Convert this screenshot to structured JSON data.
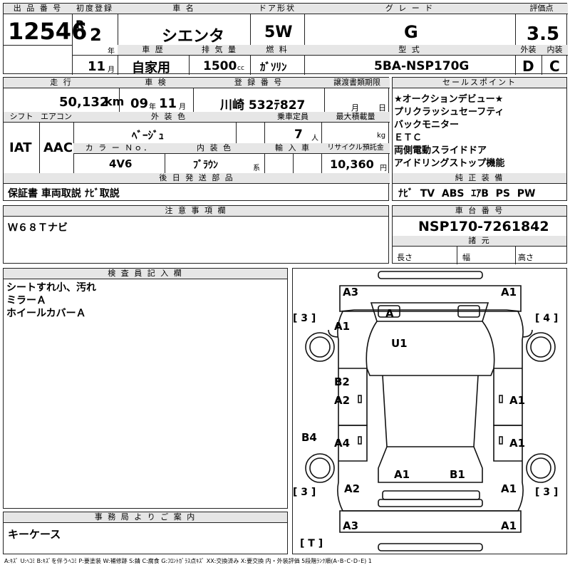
{
  "header": {
    "lot_label": "出 品 番 号",
    "lot": "12546",
    "first_reg_label": "初度登録",
    "era": "R",
    "year": "2",
    "year_unit": "年",
    "month": "11",
    "month_unit": "月",
    "car_name_label": "車 名",
    "car_name": "シエンタ",
    "door_label": "ドア形状",
    "door": "5W",
    "grade_label": "グ レ ー ド",
    "grade": "G",
    "score_label": "評価点",
    "score": "3.5",
    "history_label": "車 歴",
    "history": "自家用",
    "disp_label": "排 気 量",
    "disp": "1500",
    "disp_unit": "cc",
    "fuel_label": "燃 料",
    "fuel": "ｶﾞｿﾘﾝ",
    "model_label": "型 式",
    "model": "5BA-NSP170G",
    "ext_label": "外装",
    "ext": "D",
    "int_label": "内装",
    "int": "C"
  },
  "row2": {
    "mileage_label": "走 行",
    "mileage": "50,132",
    "mileage_unit": "km",
    "inspection_label": "車 検",
    "insp_year": "09",
    "insp_year_unit": "年",
    "insp_month": "11",
    "insp_month_unit": "月",
    "plate_label": "登 録 番 号",
    "plate": "川崎 532ﾃ827",
    "transfer_label": "譲渡書類期限",
    "transfer_month": "月",
    "transfer_day": "日",
    "shift_label": "シフト",
    "shift": "IAT",
    "ac_label": "エアコン",
    "ac": "AAC",
    "color_label": "外 装 色",
    "color": "ﾍﾞｰｼﾞｭ",
    "capacity_label": "乗車定員",
    "capacity": "7",
    "capacity_unit": "人",
    "load_label": "最大積載量",
    "load_unit": "kg",
    "colorno_label": "カ ラ ー Ｎｏ．",
    "colorno": "4V6",
    "interior_label": "内 装 色",
    "interior": "ﾌﾞﾗｳﾝ",
    "interior_unit": "系",
    "import_label": "輸 入 車",
    "recycle_label": "リサイクル預託金",
    "recycle": "10,360",
    "recycle_unit": "円",
    "later_label": "後 日 発 送 部 品",
    "later": "保証書 車両取説 ﾅﾋﾞ取説"
  },
  "sales": {
    "label": "セールスポイント",
    "points": [
      "★オークションデビュー★",
      "プリクラッシュセーフティ",
      "バックモニター",
      "ＥＴＣ",
      "両側電動スライドドア",
      "アイドリングストップ機能"
    ],
    "equip_label": "純 正 装 備",
    "equip": "ﾅﾋﾞ  TV  ABS  ｴｱB  PS  PW"
  },
  "notes": {
    "label": "注 意 事 項 欄",
    "text": "Ｗ６８Ｔナビ"
  },
  "chassis": {
    "label": "車 台 番 号",
    "value": "NSP170-7261842",
    "dims_label": "諸 元",
    "length": "長さ",
    "width": "幅",
    "height": "高さ"
  },
  "inspector": {
    "label": "検 査 員 記 入 欄",
    "lines": [
      "シートすれ小、汚れ",
      "ミラーＡ",
      "ホイールカバーＡ"
    ]
  },
  "office": {
    "label": "事 務 局 よ り ご 案 内",
    "text": "キーケース"
  },
  "diagram": {
    "marks": [
      "A3",
      "A1",
      "A",
      "A1",
      "U1",
      "B2",
      "A2",
      "A1",
      "B4",
      "A4",
      "A1",
      "A1",
      "B1",
      "A2",
      "A1",
      "A3",
      "A1"
    ],
    "tire_fl": "[ 3 ]",
    "tire_fr": "[ 4 ]",
    "tire_rl": "[ 3 ]",
    "tire_rr": "[ 3 ]",
    "spare": "[ T ]"
  },
  "legend": "A:ｷｽﾞ U:ﾍｺﾐ B:ｷｽﾞを伴うﾍｺﾐ P:要塗装 W:補修跡 S:錆 C:腐食 G:ﾌﾛﾝﾄｶﾞﾗｽ点ｷｽﾞ XX:交換済み X:要交換 内・外装評価 5段階ﾗﾝｸ順(A･B･C･D･E) 1"
}
